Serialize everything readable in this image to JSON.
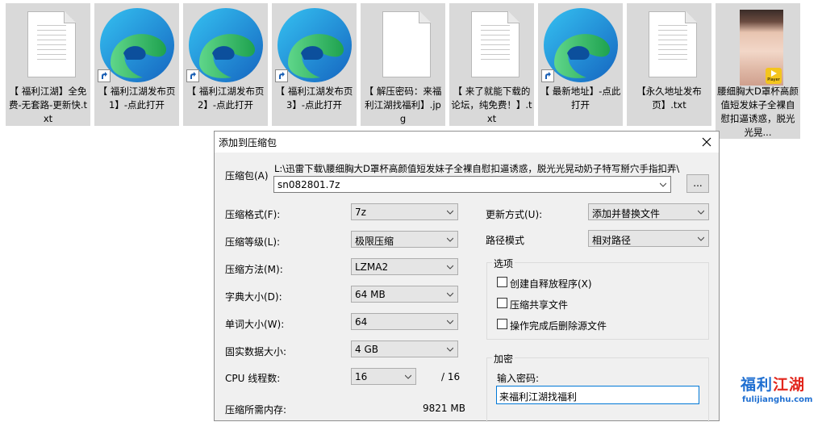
{
  "files": [
    {
      "name": "【 福利江湖】全免费-无套路-更新快.txt",
      "icon": "text-file-icon"
    },
    {
      "name": "【 福利江湖发布页1】-点此打开",
      "icon": "edge-browser-icon"
    },
    {
      "name": "【 福利江湖发布页2】-点此打开",
      "icon": "edge-browser-icon"
    },
    {
      "name": "【 福利江湖发布页3】-点此打开",
      "icon": "edge-browser-icon"
    },
    {
      "name": "【 解压密码：来福利江湖找福利】.jpg",
      "icon": "image-file-icon"
    },
    {
      "name": "【 来了就能下载的论坛，纯免费！】.txt",
      "icon": "text-file-icon"
    },
    {
      "name": "【 最新地址】-点此打开",
      "icon": "edge-browser-icon"
    },
    {
      "name": "【永久地址发布页】.txt",
      "icon": "text-file-icon"
    },
    {
      "name": "腰细胸大D罩杯高颜值短发妹子全裸自慰扣逼诱惑，脱光光晃...",
      "icon": "video-thumbnail",
      "badge": "Player"
    }
  ],
  "dialog": {
    "title": "添加到压缩包",
    "archive_label": "压缩包(A)",
    "archive_path": "L:\\迅雷下载\\腰细胸大D罩杯高颜值短发妹子全裸自慰扣逼诱惑，脱光光晃动奶子特写掰穴手指扣弄\\",
    "archive_name": "sn082801.7z",
    "browse_label": "...",
    "format_label": "压缩格式(F):",
    "format_value": "7z",
    "level_label": "压缩等级(L):",
    "level_value": "极限压缩",
    "method_label": "压缩方法(M):",
    "method_value": "LZMA2",
    "dict_label": "字典大小(D):",
    "dict_value": "64 MB",
    "word_label": "单词大小(W):",
    "word_value": "64",
    "solid_label": "固实数据大小:",
    "solid_value": "4 GB",
    "threads_label": "CPU 线程数:",
    "threads_value": "16",
    "threads_total": "/ 16",
    "memory_label": "压缩所需内存:",
    "memory_value": "9821 MB",
    "update_label": "更新方式(U):",
    "update_value": "添加并替换文件",
    "path_label": "路径模式",
    "path_value": "相对路径",
    "options_title": "选项",
    "opt_sfx": "创建自释放程序(X)",
    "opt_shared": "压缩共享文件",
    "opt_delete": "操作完成后删除源文件",
    "encrypt_title": "加密",
    "password_label": "输入密码:",
    "password_value": "来福利江湖找福利"
  },
  "watermark": {
    "line1": "福利",
    "line1b": "江湖",
    "line2": "fulijianghu.com"
  },
  "colors": {
    "dialog_bg": "#f0f0f0",
    "focus_border": "#0078d7",
    "watermark_blue": "#1f6fd1",
    "watermark_red": "#e2261c"
  }
}
